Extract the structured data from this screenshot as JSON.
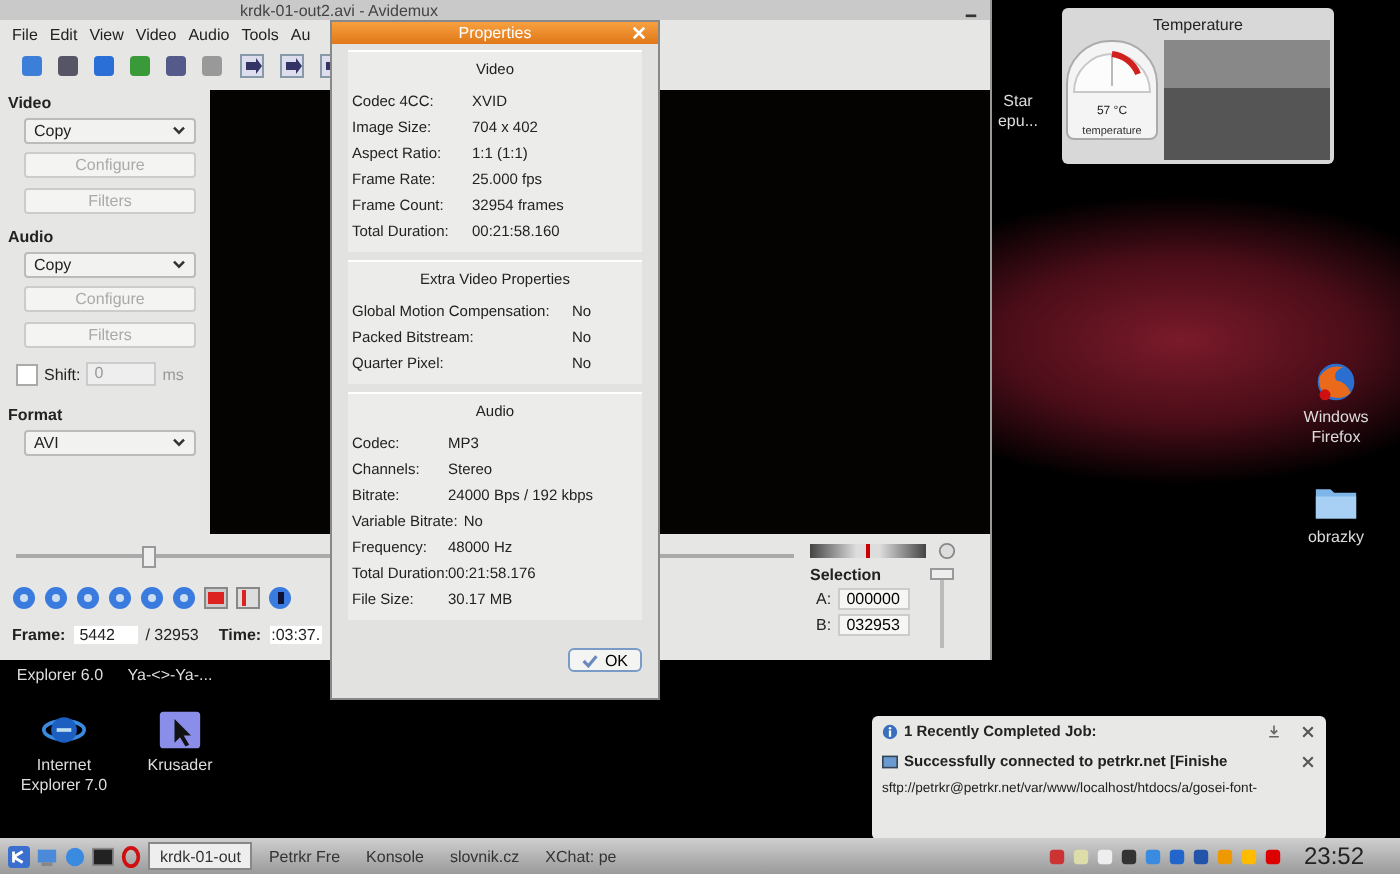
{
  "desktop_icons": [
    {
      "kind": "label",
      "lines": [
        "Star",
        "epu..."
      ]
    },
    {
      "kind": "firefox",
      "lines": [
        "Windows",
        "Firefox"
      ]
    },
    {
      "kind": "folder",
      "lines": [
        "obrazky"
      ]
    },
    {
      "kind": "label",
      "lines": [
        "Explorer 6.0"
      ]
    },
    {
      "kind": "label",
      "lines": [
        "Ya-<>-Ya-..."
      ]
    },
    {
      "kind": "ie",
      "lines": [
        "Internet",
        "Explorer 7.0"
      ]
    },
    {
      "kind": "krusader",
      "lines": [
        "Krusader"
      ]
    }
  ],
  "avidemux": {
    "title": "krdk-01-out2.avi - Avidemux",
    "menu": [
      "File",
      "Edit",
      "View",
      "Video",
      "Audio",
      "Tools",
      "Au"
    ],
    "sections": [
      {
        "label": "Video",
        "codec": "Copy",
        "buttons": [
          {
            "label": "Configure",
            "disabled": true
          },
          {
            "label": "Filters",
            "disabled": true
          }
        ]
      },
      {
        "label": "Audio",
        "codec": "Copy",
        "buttons": [
          {
            "label": "Configure",
            "disabled": true
          },
          {
            "label": "Filters",
            "disabled": true
          }
        ]
      }
    ],
    "shift": {
      "label": "Shift:",
      "checked": false,
      "value": "0",
      "unit": "ms"
    },
    "format": {
      "label": "Format",
      "value": "AVI"
    },
    "slider": {
      "level": 0.17
    },
    "frame": {
      "label": "Frame:",
      "value": "5442",
      "total": "/ 32953"
    },
    "time": {
      "label": "Time:",
      "value": ":03:37."
    },
    "selection": {
      "label": "Selection",
      "a_label": "A:",
      "a": "000000",
      "b_label": "B:",
      "b": "032953",
      "level": 1
    }
  },
  "properties": {
    "title": "Properties",
    "sections": [
      {
        "title": "Video",
        "rows": [
          [
            "Codec 4CC:",
            "XVID"
          ],
          [
            "Image Size:",
            "704 x 402"
          ],
          [
            "Aspect Ratio:",
            "1:1 (1:1)"
          ],
          [
            "Frame Rate:",
            "25.000 fps"
          ],
          [
            "Frame Count:",
            "32954 frames"
          ],
          [
            "Total Duration:",
            "00:21:58.160"
          ]
        ]
      },
      {
        "title": "Extra Video Properties",
        "rows": [
          [
            "Global Motion Compensation:",
            "No"
          ],
          [
            "Packed Bitstream:",
            "No"
          ],
          [
            "Quarter Pixel:",
            "No"
          ]
        ]
      },
      {
        "title": "Audio",
        "rows": [
          [
            "Codec:",
            "MP3"
          ],
          [
            "Channels:",
            "Stereo"
          ],
          [
            "Bitrate:",
            "24000 Bps / 192 kbps"
          ],
          [
            "Variable Bitrate:",
            "No"
          ],
          [
            "Frequency:",
            "48000 Hz"
          ],
          [
            "Total Duration:",
            "00:21:58.176"
          ],
          [
            "File Size:",
            "30.17 MB"
          ]
        ]
      }
    ],
    "ok": "OK"
  },
  "temperature": {
    "title": "Temperature",
    "reading": "57 °C",
    "gauge_label": "temperature"
  },
  "notification": {
    "title": "1 Recently Completed Job:",
    "job": "Successfully connected to petrkr.net [Finishe",
    "detail": "sftp://petrkr@petrkr.net/var/www/localhost/htdocs/a/gosei-font-"
  },
  "taskbar": {
    "tasks": [
      {
        "label": "krdk-01-out",
        "selected": true
      },
      {
        "label": "Petrkr Fre",
        "selected": false
      },
      {
        "label": "Konsole",
        "selected": false
      },
      {
        "label": "slovnik.cz",
        "selected": false
      },
      {
        "label": "XChat: pe",
        "selected": false
      }
    ],
    "clock": "23:52"
  }
}
